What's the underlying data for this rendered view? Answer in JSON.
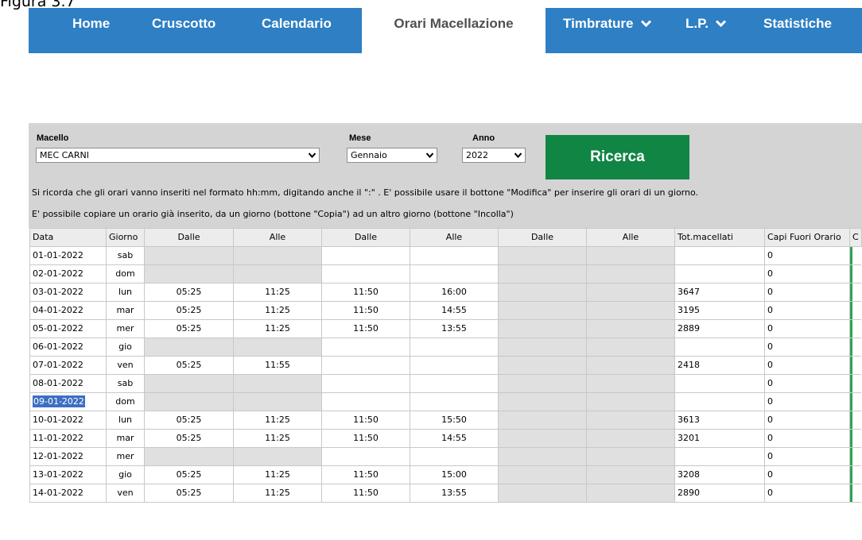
{
  "caption": "Figura 3.7",
  "nav": {
    "tabs": [
      {
        "label": "Home"
      },
      {
        "label": "Cruscotto"
      },
      {
        "label": "Calendario"
      },
      {
        "label": "Orari Macellazione"
      },
      {
        "label": "Timbrature"
      },
      {
        "label": "L.P."
      },
      {
        "label": "Statistiche"
      }
    ]
  },
  "form": {
    "macello_label": "Macello",
    "macello_value": "MEC CARNI",
    "mese_label": "Mese",
    "mese_value": "Gennaio",
    "anno_label": "Anno",
    "anno_value": "2022",
    "search_label": "Ricerca"
  },
  "notes": {
    "line1": "Si ricorda che gli orari vanno inseriti nel formato hh:mm, digitando anche il \":\" . E' possibile usare il bottone \"Modifica\" per inserire gli orari di un giorno.",
    "line2": "E' possibile copiare un orario già inserito, da un giorno (bottone \"Copia\") ad un altro giorno (bottone \"Incolla\")"
  },
  "table": {
    "headers": [
      "Data",
      "Giorno",
      "Dalle",
      "Alle",
      "Dalle",
      "Alle",
      "Dalle",
      "Alle",
      "Tot.macellati",
      "Capi Fuori Orario",
      "C"
    ],
    "rows": [
      [
        "01-01-2022",
        "sab",
        "",
        "",
        "",
        "",
        "",
        "",
        "",
        "0"
      ],
      [
        "02-01-2022",
        "dom",
        "",
        "",
        "",
        "",
        "",
        "",
        "",
        "0"
      ],
      [
        "03-01-2022",
        "lun",
        "05:25",
        "11:25",
        "11:50",
        "16:00",
        "",
        "",
        "3647",
        "0"
      ],
      [
        "04-01-2022",
        "mar",
        "05:25",
        "11:25",
        "11:50",
        "14:55",
        "",
        "",
        "3195",
        "0"
      ],
      [
        "05-01-2022",
        "mer",
        "05:25",
        "11:25",
        "11:50",
        "13:55",
        "",
        "",
        "2889",
        "0"
      ],
      [
        "06-01-2022",
        "gio",
        "",
        "",
        "",
        "",
        "",
        "",
        "",
        "0"
      ],
      [
        "07-01-2022",
        "ven",
        "05:25",
        "11:55",
        "",
        "",
        "",
        "",
        "2418",
        "0"
      ],
      [
        "08-01-2022",
        "sab",
        "",
        "",
        "",
        "",
        "",
        "",
        "",
        "0"
      ],
      [
        "09-01-2022",
        "dom",
        "",
        "",
        "",
        "",
        "",
        "",
        "",
        "0"
      ],
      [
        "10-01-2022",
        "lun",
        "05:25",
        "11:25",
        "11:50",
        "15:50",
        "",
        "",
        "3613",
        "0"
      ],
      [
        "11-01-2022",
        "mar",
        "05:25",
        "11:25",
        "11:50",
        "14:55",
        "",
        "",
        "3201",
        "0"
      ],
      [
        "12-01-2022",
        "mer",
        "",
        "",
        "",
        "",
        "",
        "",
        "",
        "0"
      ],
      [
        "13-01-2022",
        "gio",
        "05:25",
        "11:25",
        "11:50",
        "15:00",
        "",
        "",
        "3208",
        "0"
      ],
      [
        "14-01-2022",
        "ven",
        "05:25",
        "11:25",
        "11:50",
        "13:55",
        "",
        "",
        "2890",
        "0"
      ]
    ],
    "selected_row": 8
  },
  "colors": {
    "nav_bg": "#2e7fc4",
    "panel_bg": "#d4d4d4",
    "search_button": "#118544",
    "selection": "#3c6fc2",
    "row_edge": "#2ea44f"
  },
  "icons": {
    "nav_dropdown": "chevron-down-icon",
    "select_dropdown": "caret-down-icon"
  }
}
